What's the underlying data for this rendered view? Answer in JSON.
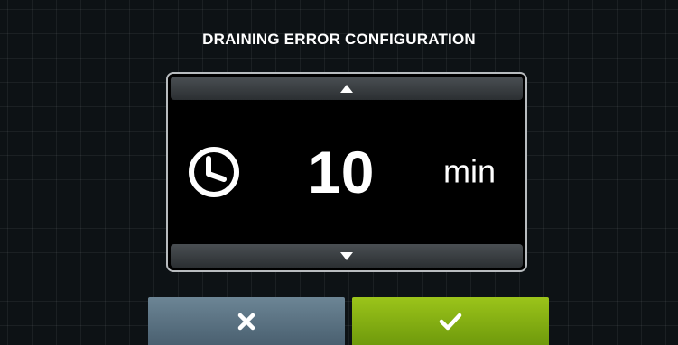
{
  "screen": {
    "title": "DRAINING ERROR CONFIGURATION"
  },
  "setting": {
    "icon": "clock-icon",
    "value": "10",
    "unit": "min"
  },
  "controls": {
    "increase_icon": "triangle-up-icon",
    "decrease_icon": "triangle-down-icon"
  },
  "buttons": {
    "cancel_icon": "x-icon",
    "confirm_icon": "checkmark-icon"
  },
  "colors": {
    "background": "#0d1215",
    "cancel": "#5b7382",
    "confirm": "#86b012",
    "panel_border": "#b8bcbf"
  }
}
